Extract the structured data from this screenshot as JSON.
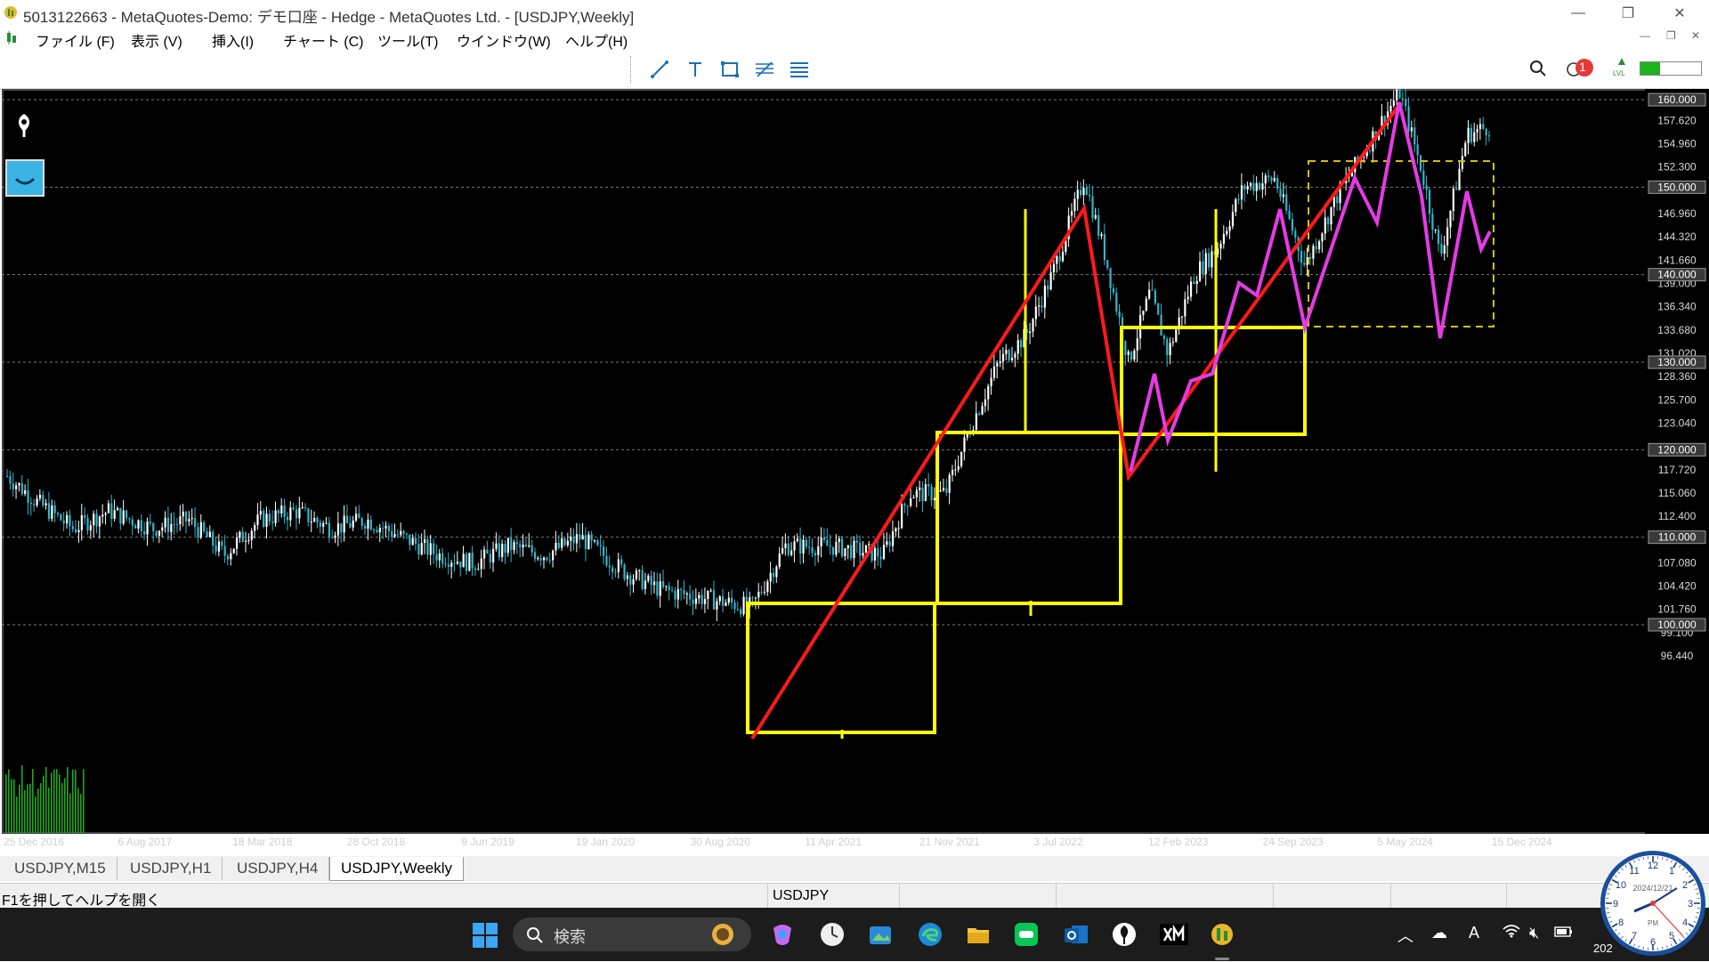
{
  "window": {
    "title": "5013122663 - MetaQuotes-Demo: デモ口座 - Hedge - MetaQuotes Ltd. - [USDJPY,Weekly]",
    "minimize": "—",
    "maximize": "❐",
    "close": "✕"
  },
  "menu": {
    "items": [
      "ファイル (F)",
      "表示 (V)",
      "挿入(I)",
      "チャート (C)",
      "ツール(T)",
      "ウインドウ(W)",
      "ヘルプ(H)"
    ]
  },
  "toolbar": {
    "tools": [
      "trendline-icon",
      "text-icon",
      "rectangle-icon",
      "fibonacci-icon",
      "channel-icon"
    ],
    "notification_count": "1",
    "level_label": "LVL"
  },
  "chart": {
    "symbol": "USDJPY",
    "timeframe": "Weekly",
    "colors": {
      "background": "#000000",
      "bull_candle": "#ffffff",
      "bear_candle": "#2fb8cc",
      "trend_red": "#ff1a1a",
      "boxes_yellow": "#ffff00",
      "zigzag_magenta": "#e53be5",
      "volume_green": "#1fa81f"
    },
    "price_labels": [
      "157.620",
      "154.960",
      "152.300",
      "146.960",
      "144.320",
      "141.660",
      "139.000",
      "136.340",
      "133.680",
      "131.020",
      "128.360",
      "125.700",
      "123.040",
      "117.720",
      "115.060",
      "112.400",
      "107.080",
      "104.420",
      "101.760",
      "99.100",
      "96.440"
    ],
    "level_labels": [
      "160.000",
      "150.000",
      "140.000",
      "130.000",
      "120.000",
      "110.000",
      "100.000"
    ],
    "date_labels": [
      "25 Dec 2016",
      "6 Aug 2017",
      "18 Mar 2018",
      "28 Oct 2018",
      "9 Jun 2019",
      "19 Jan 2020",
      "30 Aug 2020",
      "11 Apr 2021",
      "21 Nov 2021",
      "3 Jul 2022",
      "12 Feb 2023",
      "24 Sep 2023",
      "5 May 2024",
      "15 Dec 2024"
    ]
  },
  "chart_data": {
    "type": "candlestick",
    "symbol": "USDJPY",
    "timeframe": "Weekly",
    "x": [
      "2016-12",
      "2017-06",
      "2017-12",
      "2018-06",
      "2018-12",
      "2019-06",
      "2019-12",
      "2020-06",
      "2020-12",
      "2021-06",
      "2021-12",
      "2022-04",
      "2022-07",
      "2022-10",
      "2023-01",
      "2023-06",
      "2023-10",
      "2024-01",
      "2024-04",
      "2024-07",
      "2024-09",
      "2024-12"
    ],
    "close_approx": [
      117,
      111,
      113,
      110,
      111,
      108,
      109,
      107,
      103,
      110,
      115,
      126,
      138,
      148,
      128,
      144,
      149,
      141,
      155,
      161,
      141,
      157
    ],
    "ylim": [
      95,
      162
    ],
    "horizontal_levels": [
      160,
      150,
      140,
      130,
      120,
      110,
      100
    ]
  },
  "tabs": [
    "USDJPY,M15",
    "USDJPY,H1",
    "USDJPY,H4",
    "USDJPY,Weekly"
  ],
  "status": {
    "help": "F1を押してヘルプを開く",
    "symbol": "USDJPY"
  },
  "taskbar": {
    "search_placeholder": "検索",
    "clock_date": "2024/12/21",
    "clock_ampm": "PM",
    "time_fragment": "202"
  }
}
